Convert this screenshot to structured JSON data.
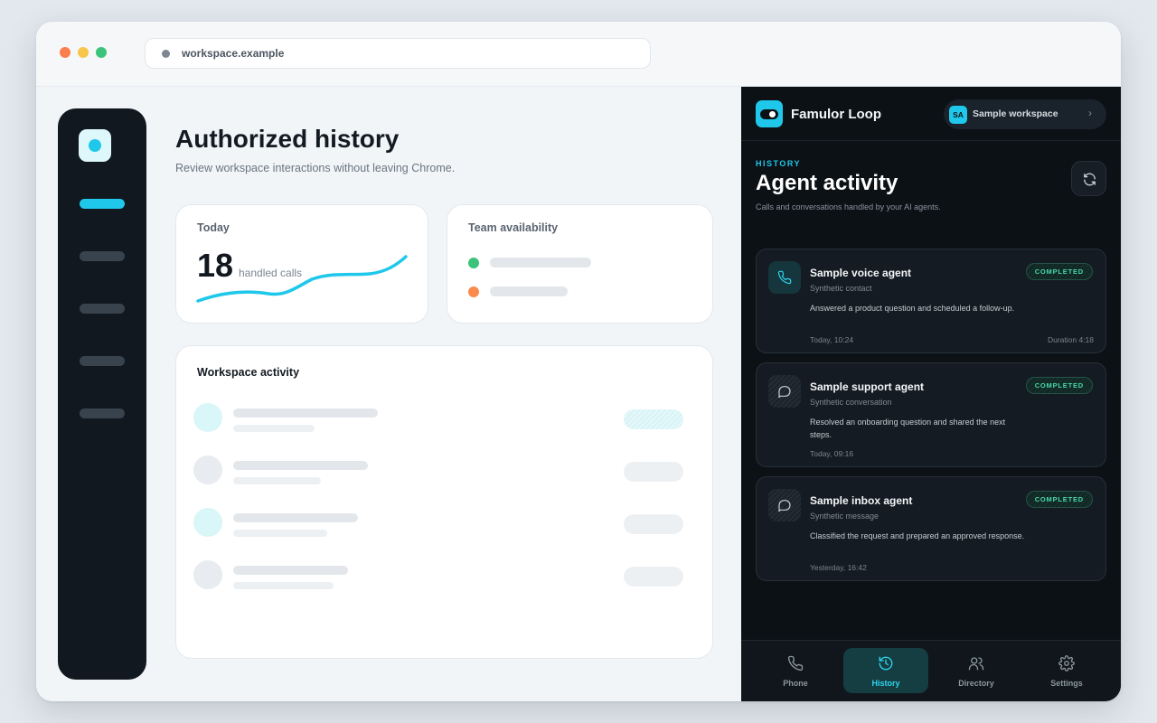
{
  "browser": {
    "url": "workspace.example"
  },
  "main": {
    "title": "Authorized history",
    "subtitle": "Review workspace interactions without leaving Chrome.",
    "today_card": {
      "label": "Today",
      "value": "18",
      "unit": "handled calls"
    },
    "team_card": {
      "label": "Team availability"
    },
    "activity_card": {
      "label": "Workspace activity"
    }
  },
  "panel": {
    "brand": "Famulor Loop",
    "workspace": {
      "initials": "SA",
      "name": "Sample workspace"
    },
    "section_label": "HISTORY",
    "title": "Agent activity",
    "subtitle": "Calls and conversations handled by your AI agents.",
    "agents": [
      {
        "name": "Sample voice agent",
        "type": "Synthetic contact",
        "status": "COMPLETED",
        "description": "Answered a product question and scheduled a follow-up.",
        "time": "Today, 10:24",
        "duration": "Duration 4:18",
        "icon": "phone-icon"
      },
      {
        "name": "Sample support agent",
        "type": "Synthetic conversation",
        "status": "COMPLETED",
        "description": "Resolved an onboarding question and shared the next steps.",
        "time": "Today, 09:16",
        "icon": "chat-icon"
      },
      {
        "name": "Sample inbox agent",
        "type": "Synthetic message",
        "status": "COMPLETED",
        "description": "Classified the request and prepared an approved response.",
        "time": "Yesterday, 16:42",
        "icon": "chat-icon"
      }
    ],
    "nav": [
      {
        "label": "Phone",
        "icon": "phone-icon"
      },
      {
        "label": "History",
        "icon": "history-icon"
      },
      {
        "label": "Directory",
        "icon": "users-icon"
      },
      {
        "label": "Settings",
        "icon": "gear-icon"
      }
    ]
  },
  "colors": {
    "accent": "#1fc8ea",
    "status_green": "#46d8a8",
    "panel_bg": "#0c1116",
    "available": "#3cc37a",
    "away": "#fb8a4c"
  }
}
